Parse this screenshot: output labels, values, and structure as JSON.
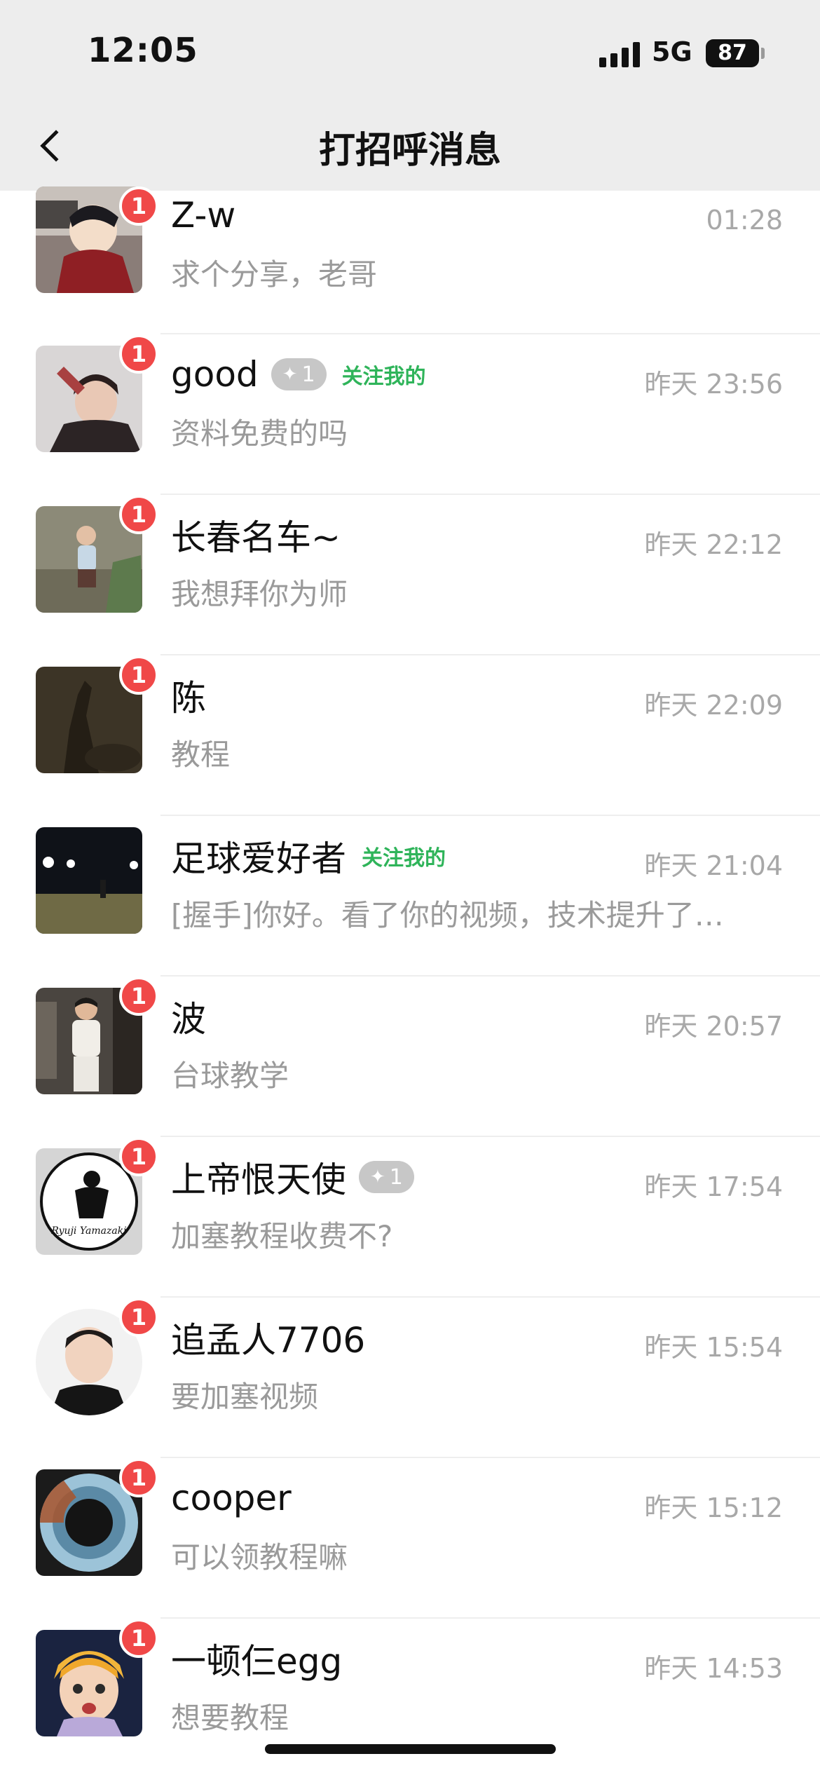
{
  "status": {
    "time": "12:05",
    "network": "5G",
    "battery": "87"
  },
  "nav": {
    "title": "打招呼消息"
  },
  "messages": [
    {
      "name": "Z-w",
      "tag": "",
      "follow": "",
      "time": "01:28",
      "preview": "求个分享，老哥",
      "badge": "1"
    },
    {
      "name": "good",
      "tag": "1",
      "follow": "关注我的",
      "time": "昨天 23:56",
      "preview": "资料免费的吗",
      "badge": "1"
    },
    {
      "name": "长春名车~",
      "tag": "",
      "follow": "",
      "time": "昨天 22:12",
      "preview": "我想拜你为师",
      "badge": "1"
    },
    {
      "name": "陈",
      "tag": "",
      "follow": "",
      "time": "昨天 22:09",
      "preview": "教程",
      "badge": "1"
    },
    {
      "name": "足球爱好者",
      "tag": "",
      "follow": "关注我的",
      "time": "昨天 21:04",
      "preview": "[握手]你好。看了你的视频，技术提升了…",
      "badge": ""
    },
    {
      "name": "波",
      "tag": "",
      "follow": "",
      "time": "昨天 20:57",
      "preview": "台球教学",
      "badge": "1"
    },
    {
      "name": "上帝恨天使",
      "tag": "1",
      "follow": "",
      "time": "昨天 17:54",
      "preview": "加塞教程收费不?",
      "badge": "1",
      "avatar_text": "Ryuji Yamazaki"
    },
    {
      "name": "追孟人7706",
      "tag": "",
      "follow": "",
      "time": "昨天 15:54",
      "preview": "要加塞视频",
      "badge": "1"
    },
    {
      "name": "cooper",
      "tag": "",
      "follow": "",
      "time": "昨天 15:12",
      "preview": "可以领教程嘛",
      "badge": "1"
    },
    {
      "name": "一顿仨egg",
      "tag": "",
      "follow": "",
      "time": "昨天 14:53",
      "preview": "想要教程",
      "badge": "1"
    }
  ],
  "colors": {
    "badge": "#f04848",
    "follow": "#2fb45a",
    "nav_bg": "#ededed"
  }
}
